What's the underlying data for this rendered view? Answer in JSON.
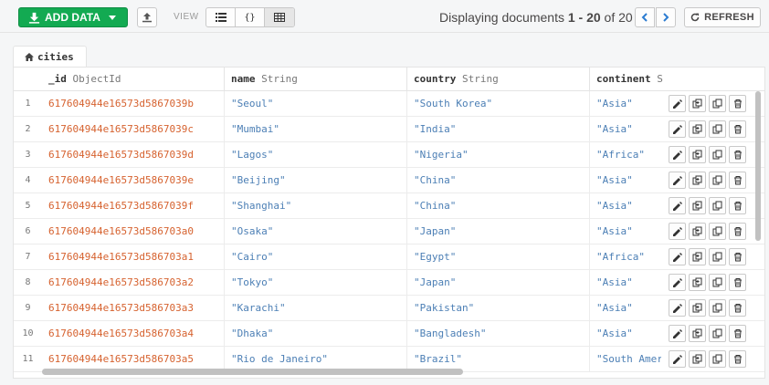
{
  "toolbar": {
    "add_data_label": "ADD DATA",
    "view_label": "VIEW",
    "view_modes": [
      "list",
      "json",
      "table"
    ],
    "displaying_prefix": "Displaying documents ",
    "range": "1 - 20",
    "of_text": " of ",
    "total": "20",
    "refresh_label": "REFRESH"
  },
  "tab": {
    "label": "cities"
  },
  "columns": [
    {
      "name": "_id",
      "type": "ObjectId"
    },
    {
      "name": "name",
      "type": "String"
    },
    {
      "name": "country",
      "type": "String"
    },
    {
      "name": "continent",
      "type": "S"
    }
  ],
  "rows": [
    {
      "n": "1",
      "id": "617604944e16573d5867039b",
      "name": "\"Seoul\"",
      "country": "\"South Korea\"",
      "continent": "\"Asia\""
    },
    {
      "n": "2",
      "id": "617604944e16573d5867039c",
      "name": "\"Mumbai\"",
      "country": "\"India\"",
      "continent": "\"Asia\""
    },
    {
      "n": "3",
      "id": "617604944e16573d5867039d",
      "name": "\"Lagos\"",
      "country": "\"Nigeria\"",
      "continent": "\"Africa\""
    },
    {
      "n": "4",
      "id": "617604944e16573d5867039e",
      "name": "\"Beijing\"",
      "country": "\"China\"",
      "continent": "\"Asia\""
    },
    {
      "n": "5",
      "id": "617604944e16573d5867039f",
      "name": "\"Shanghai\"",
      "country": "\"China\"",
      "continent": "\"Asia\""
    },
    {
      "n": "6",
      "id": "617604944e16573d586703a0",
      "name": "\"Osaka\"",
      "country": "\"Japan\"",
      "continent": "\"Asia\""
    },
    {
      "n": "7",
      "id": "617604944e16573d586703a1",
      "name": "\"Cairo\"",
      "country": "\"Egypt\"",
      "continent": "\"Africa\""
    },
    {
      "n": "8",
      "id": "617604944e16573d586703a2",
      "name": "\"Tokyo\"",
      "country": "\"Japan\"",
      "continent": "\"Asia\""
    },
    {
      "n": "9",
      "id": "617604944e16573d586703a3",
      "name": "\"Karachi\"",
      "country": "\"Pakistan\"",
      "continent": "\"Asia\""
    },
    {
      "n": "10",
      "id": "617604944e16573d586703a4",
      "name": "\"Dhaka\"",
      "country": "\"Bangladesh\"",
      "continent": "\"Asia\""
    },
    {
      "n": "11",
      "id": "617604944e16573d586703a5",
      "name": "\"Rio de Janeiro\"",
      "country": "\"Brazil\"",
      "continent": "\"South Amer"
    }
  ],
  "row_action_icons": [
    "pencil-icon",
    "copy-icon",
    "clone-icon",
    "trash-icon"
  ],
  "colors": {
    "accent": "#13aa52",
    "oid": "#d6622f",
    "string": "#4c7fb5",
    "pager": "#2c7cd1"
  }
}
